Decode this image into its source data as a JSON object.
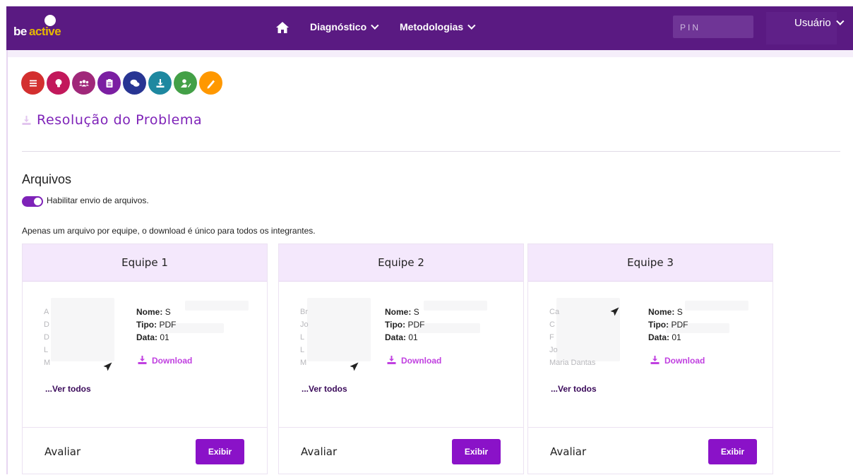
{
  "nav": {
    "logo_be": "be",
    "logo_active": "active",
    "diagnostico": "Diagnóstico",
    "metodologias": "Metodologias",
    "pin_placeholder": "PIN",
    "user": "Usuário"
  },
  "steps": [
    {
      "icon": "list-icon",
      "color": "#d32f2f"
    },
    {
      "icon": "lightbulb-icon",
      "color": "#c2185b"
    },
    {
      "icon": "users-icon",
      "color": "#a0287a"
    },
    {
      "icon": "clipboard-icon",
      "color": "#7b1fa2"
    },
    {
      "icon": "comments-icon",
      "color": "#283593"
    },
    {
      "icon": "download-icon",
      "color": "#1e88a0"
    },
    {
      "icon": "user-edit-icon",
      "color": "#43a047"
    },
    {
      "icon": "pen-icon",
      "color": "#ff9800"
    }
  ],
  "page": {
    "title": "Resolução do Problema",
    "arquivos": "Arquivos",
    "toggle_label": "Habilitar envio de arquivos.",
    "info": "Apenas um arquivo por equipe, o download é único para todos os integrantes."
  },
  "cards": [
    {
      "title": "Equipe 1",
      "members": [
        "A",
        "D",
        "D",
        "L",
        "M"
      ],
      "nome_label": "Nome:",
      "nome": "S",
      "tipo_label": "Tipo:",
      "tipo": "PDF",
      "data_label": "Data:",
      "data": "01",
      "download": "Download",
      "ver_todos": "...Ver todos",
      "avaliar": "Avaliar",
      "exibir": "Exibir"
    },
    {
      "title": "Equipe 2",
      "members": [
        "Br",
        "Jo",
        "L",
        "L",
        "M"
      ],
      "nome_label": "Nome:",
      "nome": "S",
      "tipo_label": "Tipo:",
      "tipo": "PDF",
      "data_label": "Data:",
      "data": "01",
      "download": "Download",
      "ver_todos": "...Ver todos",
      "avaliar": "Avaliar",
      "exibir": "Exibir"
    },
    {
      "title": "Equipe 3",
      "members": [
        "Ca",
        "C",
        "F",
        "Jo",
        "Maria Dantas"
      ],
      "nome_label": "Nome:",
      "nome": "S",
      "tipo_label": "Tipo:",
      "tipo": "PDF",
      "data_label": "Data:",
      "data": "01",
      "download": "Download",
      "ver_todos": "...Ver todos",
      "avaliar": "Avaliar",
      "exibir": "Exibir"
    }
  ]
}
